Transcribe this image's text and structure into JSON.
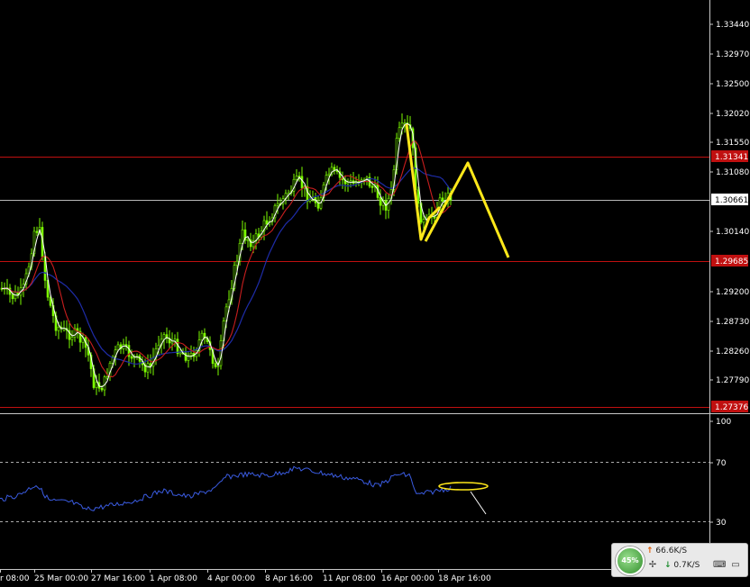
{
  "chart": {
    "price_ticks": [
      "1.33440",
      "1.32970",
      "1.32500",
      "1.32020",
      "1.31550",
      "1.31080",
      "1.30140",
      "1.29200",
      "1.28730",
      "1.28260",
      "1.27790"
    ],
    "price_labels": {
      "upper_resistance": "1.31341",
      "current_price": "1.30661",
      "support": "1.29685",
      "bottom_level": "1.27376"
    },
    "rsi_ticks": [
      "100",
      "70",
      "30"
    ],
    "time_labels": [
      "r 08:00",
      "25 Mar 00:00",
      "27 Mar 16:00",
      "1 Apr 08:00",
      "4 Apr 00:00",
      "8 Apr 16:00",
      "11 Apr 08:00",
      "16 Apr 00:00",
      "18 Apr 16:00"
    ]
  },
  "colors": {
    "background": "#000000",
    "candles": "#7CFC00",
    "fast_ma": "#ffffff",
    "mid_ma": "#c81e1e",
    "slow_ma": "#1e2ca8",
    "rsi_line": "#3a5be0",
    "annotation": "#ffe81a",
    "hline_red": "#c01010",
    "hline_current": "#b8b8b8"
  },
  "netmonitor": {
    "gauge_text": "45%",
    "upload": "66.6K/S",
    "download": "0.7K/S",
    "icons": [
      "pin-icon",
      "keyboard-icon",
      "monitor-icon"
    ]
  }
}
